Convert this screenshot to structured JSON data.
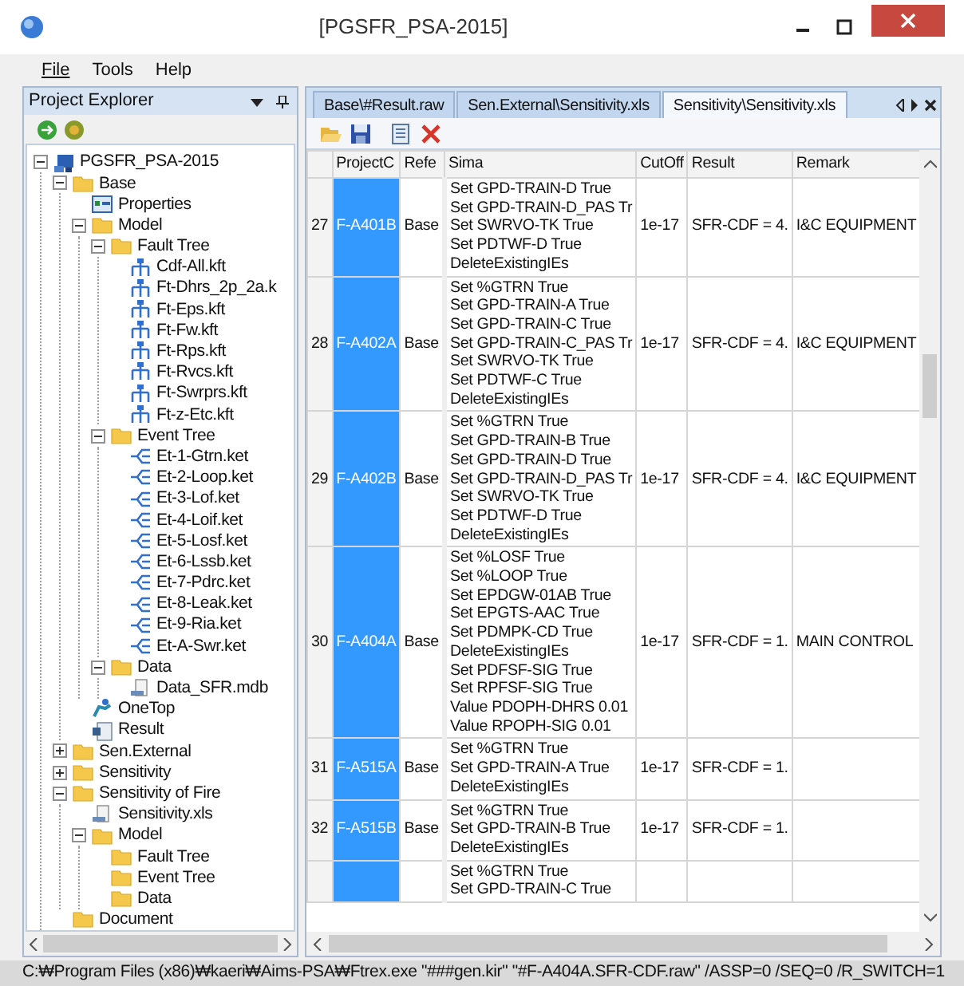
{
  "window": {
    "title": "[PGSFR_PSA-2015]"
  },
  "menu": [
    {
      "label": "File",
      "underline": true
    },
    {
      "label": "Tools",
      "underline": false
    },
    {
      "label": "Help",
      "underline": false
    }
  ],
  "explorer": {
    "title": "Project Explorer",
    "tree": [
      {
        "label": "PGSFR_PSA-2015",
        "kind": "project",
        "expanded": true,
        "children": [
          {
            "label": "Base",
            "kind": "folder",
            "expanded": true,
            "children": [
              {
                "label": "Properties",
                "kind": "properties"
              },
              {
                "label": "Model",
                "kind": "folder",
                "expanded": true,
                "children": [
                  {
                    "label": "Fault Tree",
                    "kind": "folder",
                    "expanded": true,
                    "children": [
                      {
                        "label": "Cdf-All.kft",
                        "kind": "fault"
                      },
                      {
                        "label": "Ft-Dhrs_2p_2a.k",
                        "kind": "fault"
                      },
                      {
                        "label": "Ft-Eps.kft",
                        "kind": "fault"
                      },
                      {
                        "label": "Ft-Fw.kft",
                        "kind": "fault"
                      },
                      {
                        "label": "Ft-Rps.kft",
                        "kind": "fault"
                      },
                      {
                        "label": "Ft-Rvcs.kft",
                        "kind": "fault"
                      },
                      {
                        "label": "Ft-Swrprs.kft",
                        "kind": "fault"
                      },
                      {
                        "label": "Ft-z-Etc.kft",
                        "kind": "fault"
                      }
                    ]
                  },
                  {
                    "label": "Event Tree",
                    "kind": "folder",
                    "expanded": true,
                    "children": [
                      {
                        "label": "Et-1-Gtrn.ket",
                        "kind": "event"
                      },
                      {
                        "label": "Et-2-Loop.ket",
                        "kind": "event"
                      },
                      {
                        "label": "Et-3-Lof.ket",
                        "kind": "event"
                      },
                      {
                        "label": "Et-4-Loif.ket",
                        "kind": "event"
                      },
                      {
                        "label": "Et-5-Losf.ket",
                        "kind": "event"
                      },
                      {
                        "label": "Et-6-Lssb.ket",
                        "kind": "event"
                      },
                      {
                        "label": "Et-7-Pdrc.ket",
                        "kind": "event"
                      },
                      {
                        "label": "Et-8-Leak.ket",
                        "kind": "event"
                      },
                      {
                        "label": "Et-9-Ria.ket",
                        "kind": "event"
                      },
                      {
                        "label": "Et-A-Swr.ket",
                        "kind": "event"
                      }
                    ]
                  },
                  {
                    "label": "Data",
                    "kind": "folder",
                    "expanded": true,
                    "children": [
                      {
                        "label": "Data_SFR.mdb",
                        "kind": "file"
                      }
                    ]
                  }
                ]
              },
              {
                "label": "OneTop",
                "kind": "onetop"
              },
              {
                "label": "Result",
                "kind": "result"
              }
            ]
          },
          {
            "label": "Sen.External",
            "kind": "folder",
            "expanded": false
          },
          {
            "label": "Sensitivity",
            "kind": "folder",
            "expanded": false
          },
          {
            "label": "Sensitivity of Fire",
            "kind": "folder",
            "expanded": true,
            "children": [
              {
                "label": "Sensitivity.xls",
                "kind": "file"
              },
              {
                "label": "Model",
                "kind": "folder",
                "expanded": true,
                "children": [
                  {
                    "label": "Fault Tree",
                    "kind": "folder"
                  },
                  {
                    "label": "Event Tree",
                    "kind": "folder"
                  },
                  {
                    "label": "Data",
                    "kind": "folder"
                  }
                ]
              }
            ]
          },
          {
            "label": "Document",
            "kind": "folder"
          }
        ]
      }
    ]
  },
  "tabs": [
    {
      "label": "Base\\#Result.raw",
      "selected": false
    },
    {
      "label": "Sen.External\\Sensitivity.xls",
      "selected": false
    },
    {
      "label": "Sensitivity\\Sensitivity.xls",
      "selected": true
    }
  ],
  "table": {
    "columns": [
      "ProjectC",
      "Refe",
      "Sima",
      "CutOff",
      "Result",
      "Remark"
    ],
    "rows": [
      {
        "num": "27",
        "project": "F-A401B",
        "selected": true,
        "ref": "Base",
        "sima": [
          "Set GPD-TRAIN-D True",
          "Set GPD-TRAIN-D_PAS Tr",
          "Set SWRVO-TK True",
          "Set PDTWF-D True",
          "DeleteExistingIEs"
        ],
        "cutoff": "1e-17",
        "result": "SFR-CDF = 4.",
        "remark": "I&C EQUIPMENT"
      },
      {
        "num": "28",
        "project": "F-A402A",
        "selected": true,
        "ref": "Base",
        "sima": [
          "Set %GTRN True",
          "Set GPD-TRAIN-A True",
          "Set GPD-TRAIN-C True",
          "Set GPD-TRAIN-C_PAS Tr",
          "Set SWRVO-TK True",
          "Set PDTWF-C True",
          "DeleteExistingIEs"
        ],
        "cutoff": "1e-17",
        "result": "SFR-CDF = 4.",
        "remark": "I&C EQUIPMENT"
      },
      {
        "num": "29",
        "project": "F-A402B",
        "selected": true,
        "ref": "Base",
        "sima": [
          "Set %GTRN True",
          "Set GPD-TRAIN-B True",
          "Set GPD-TRAIN-D True",
          "Set GPD-TRAIN-D_PAS Tr",
          "Set SWRVO-TK True",
          "Set PDTWF-D True",
          "DeleteExistingIEs"
        ],
        "cutoff": "1e-17",
        "result": "SFR-CDF = 4.",
        "remark": "I&C EQUIPMENT"
      },
      {
        "num": "30",
        "project": "F-A404A",
        "selected": true,
        "ref": "Base",
        "sima": [
          "Set %LOSF True",
          "Set %LOOP True",
          "Set EPDGW-01AB True",
          "Set EPGTS-AAC True",
          "Set PDMPK-CD True",
          "DeleteExistingIEs",
          "Set PDFSF-SIG True",
          "Set RPFSF-SIG True",
          "Value PDOPH-DHRS 0.01",
          "Value RPOPH-SIG 0.01"
        ],
        "cutoff": "1e-17",
        "result": "SFR-CDF = 1.",
        "remark": "MAIN CONTROL"
      },
      {
        "num": "31",
        "project": "F-A515A",
        "selected": true,
        "ref": "Base",
        "sima": [
          "Set %GTRN True",
          "Set GPD-TRAIN-A True",
          "DeleteExistingIEs"
        ],
        "cutoff": "1e-17",
        "result": "SFR-CDF = 1.",
        "remark": ""
      },
      {
        "num": "32",
        "project": "F-A515B",
        "selected": true,
        "ref": "Base",
        "sima": [
          "Set %GTRN True",
          "Set GPD-TRAIN-B True",
          "DeleteExistingIEs"
        ],
        "cutoff": "1e-17",
        "result": "SFR-CDF = 1.",
        "remark": ""
      },
      {
        "num": "",
        "project": "",
        "selected": true,
        "ref": "",
        "sima": [
          "Set %GTRN True",
          "Set GPD-TRAIN-C True"
        ],
        "cutoff": "",
        "result": "",
        "remark": ""
      }
    ]
  },
  "status_bar": "C:₩Program Files (x86)₩kaeri₩Aims-PSA₩Ftrex.exe \"###gen.kir\" \"#F-A404A.SFR-CDF.raw\" /ASSP=0 /SEQ=0 /R_SWITCH=1"
}
